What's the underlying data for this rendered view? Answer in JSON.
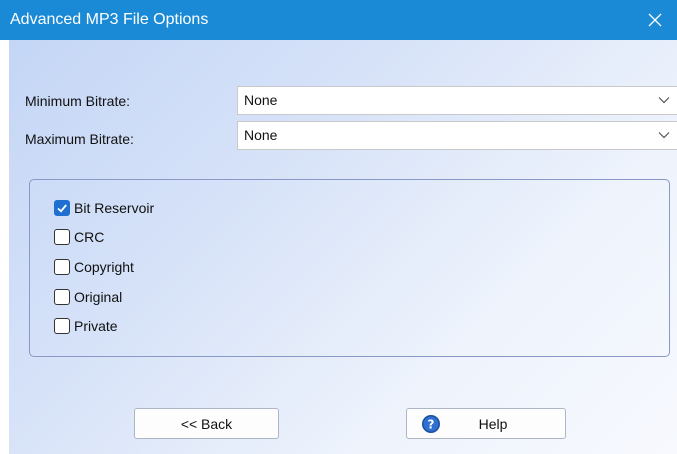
{
  "window": {
    "title": "Advanced MP3 File Options"
  },
  "bitrate": {
    "min_label": "Minimum Bitrate:",
    "min_value": "None",
    "max_label": "Maximum Bitrate:",
    "max_value": "None"
  },
  "options": [
    {
      "label": "Bit Reservoir",
      "checked": true
    },
    {
      "label": "CRC",
      "checked": false
    },
    {
      "label": "Copyright",
      "checked": false
    },
    {
      "label": "Original",
      "checked": false
    },
    {
      "label": "Private",
      "checked": false
    }
  ],
  "buttons": {
    "back_label": "<< Back",
    "help_label": "Help"
  },
  "colors": {
    "titlebar": "#1a8ad6",
    "checkbox_checked": "#1f6fd1",
    "group_border": "#8a98c8",
    "help_icon": "#1c4fa0"
  },
  "icons": [
    "close-icon",
    "chevron-down-icon",
    "checkmark-icon",
    "help-icon"
  ]
}
